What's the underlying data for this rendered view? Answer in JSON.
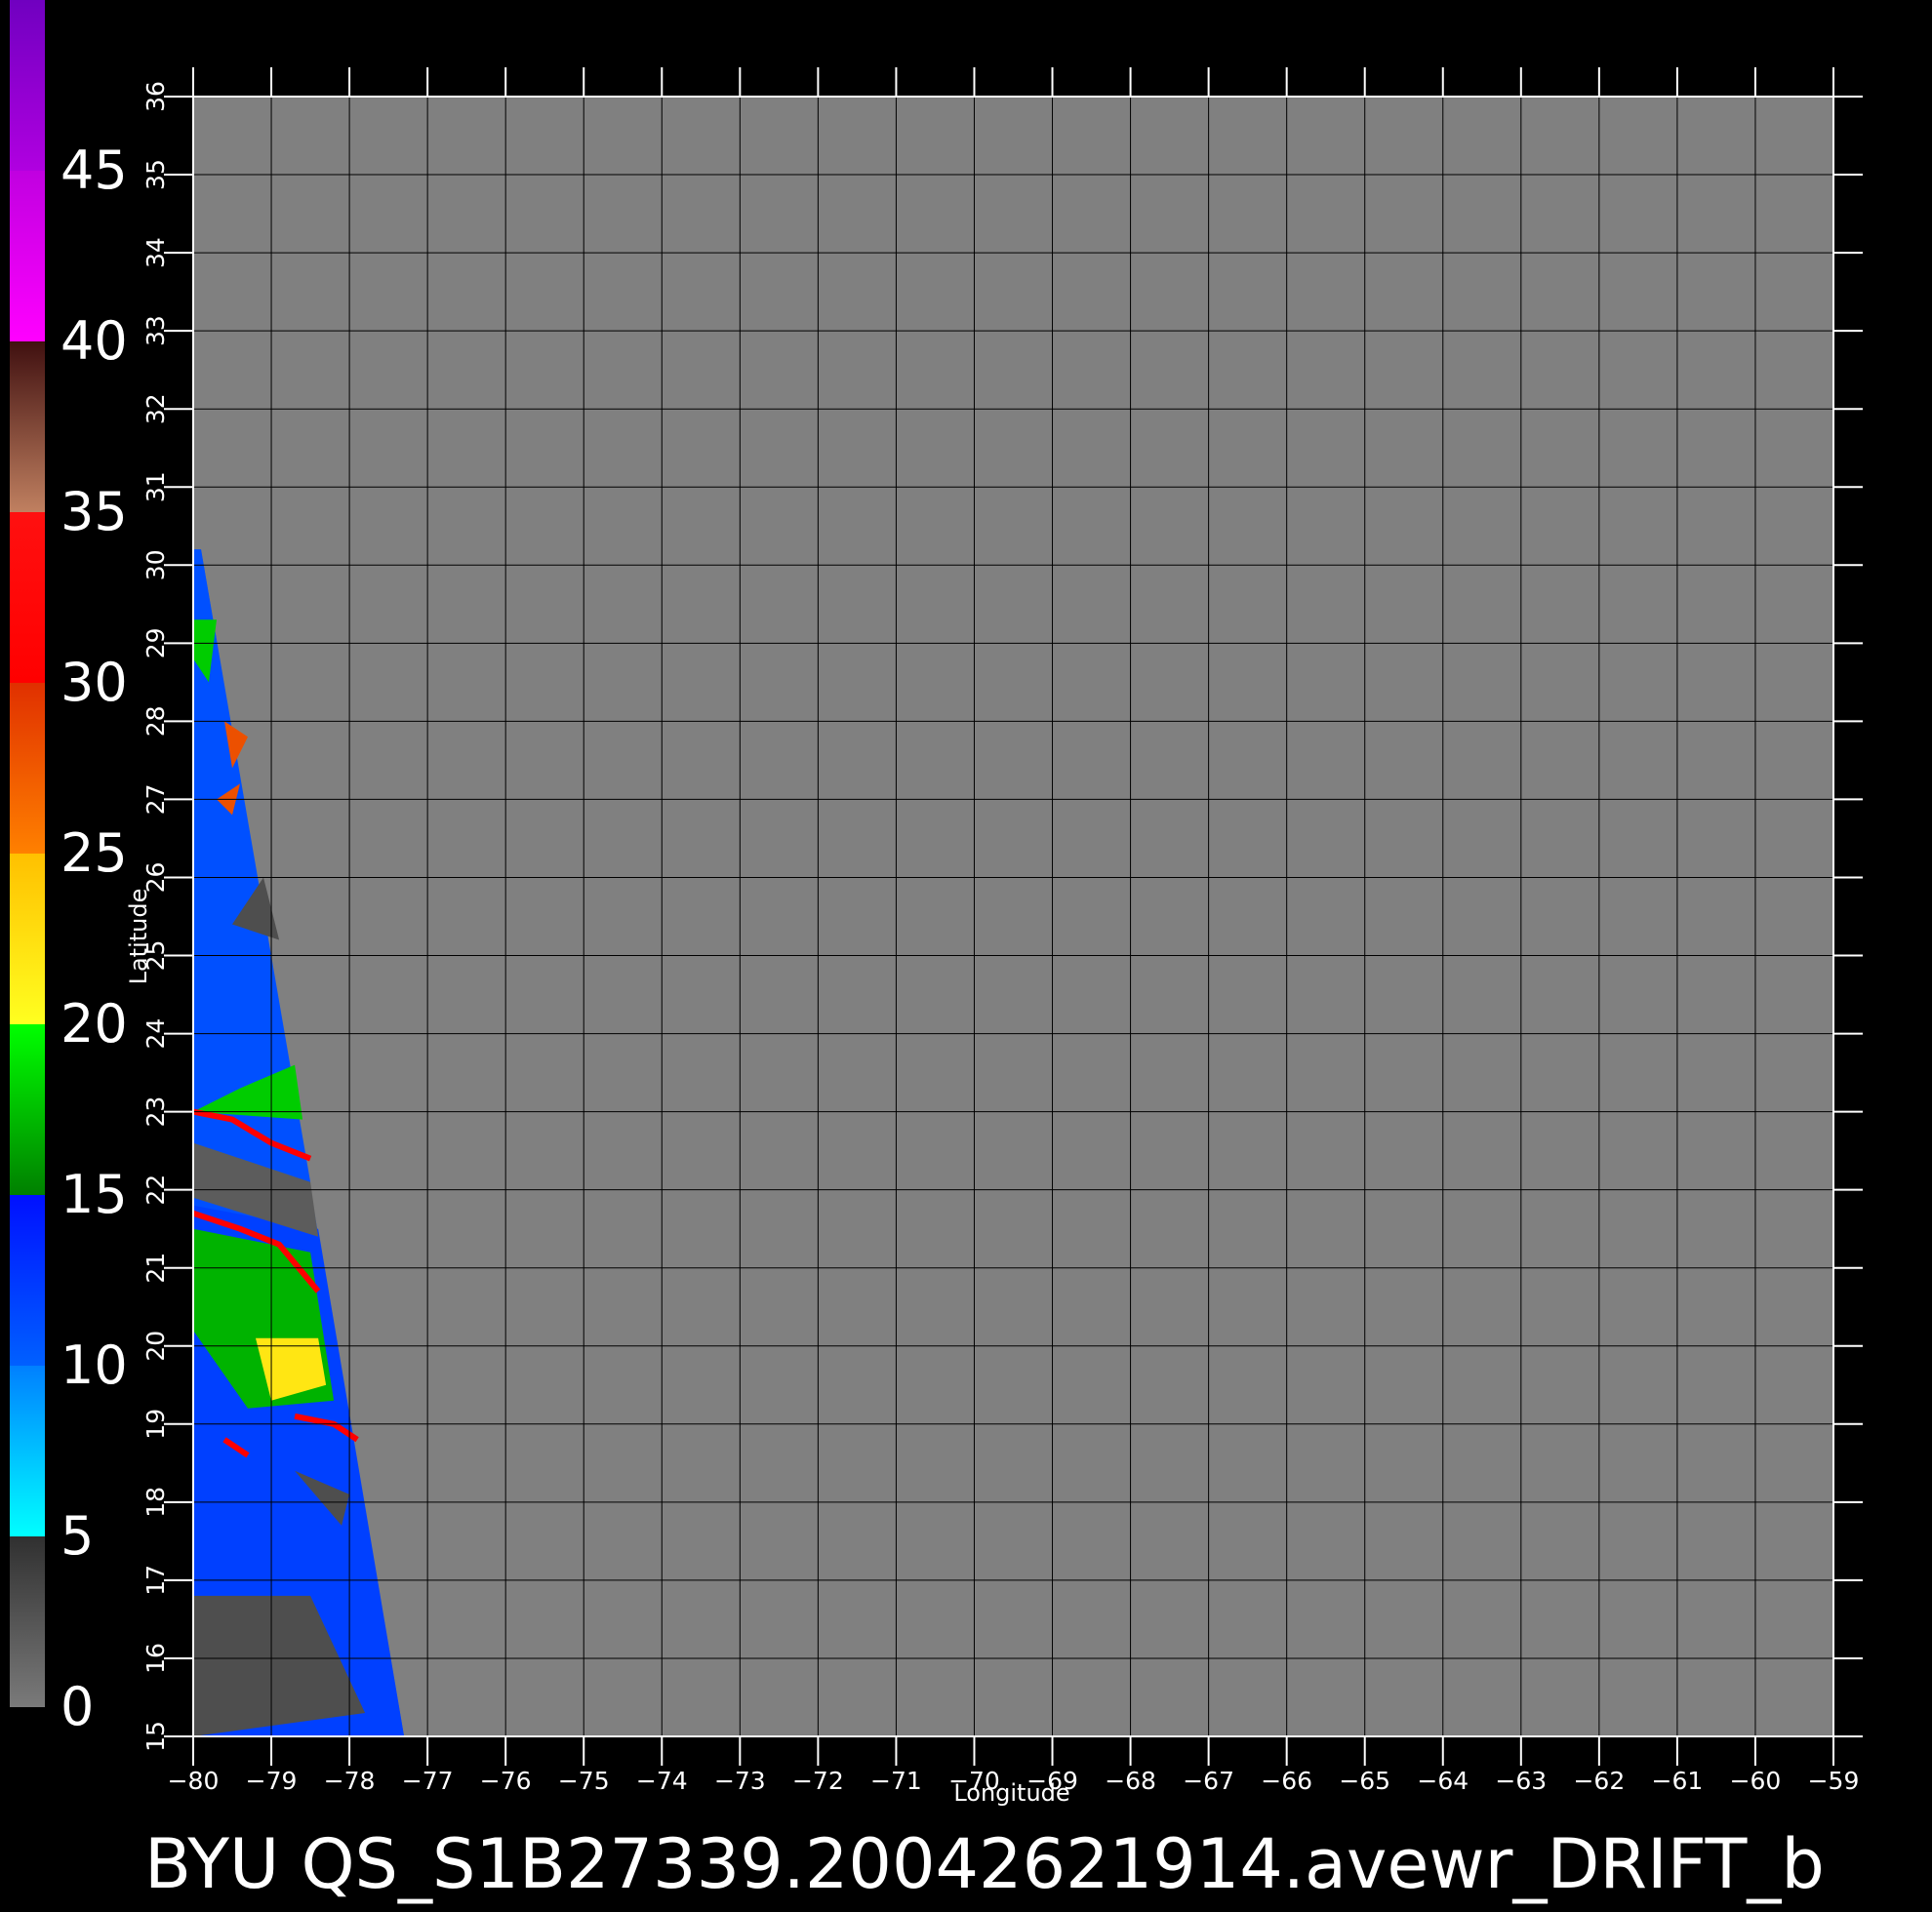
{
  "caption": "BYU  QS_S1B27339.20042621914.avewr_DRIFT_b",
  "colors": {
    "background": "#000000",
    "plot_background": "#808080",
    "grid": "#000000",
    "ticks": "#ffffff"
  },
  "colorbar": {
    "tick_labels": [
      "0",
      "5",
      "10",
      "15",
      "20",
      "25",
      "30",
      "35",
      "40",
      "45"
    ],
    "segments": [
      {
        "from": 0,
        "to": 5,
        "colors": [
          "#7a7a7a",
          "#303030"
        ]
      },
      {
        "from": 5,
        "to": 10,
        "colors": [
          "#00ffff",
          "#0080ff"
        ]
      },
      {
        "from": 10,
        "to": 15,
        "colors": [
          "#0060ff",
          "#0010ff"
        ]
      },
      {
        "from": 15,
        "to": 20,
        "colors": [
          "#008000",
          "#00ff00"
        ]
      },
      {
        "from": 20,
        "to": 25,
        "colors": [
          "#ffff20",
          "#ffc000"
        ]
      },
      {
        "from": 25,
        "to": 30,
        "colors": [
          "#ff8000",
          "#e03000"
        ]
      },
      {
        "from": 30,
        "to": 35,
        "colors": [
          "#ff0000",
          "#ff1010"
        ]
      },
      {
        "from": 35,
        "to": 40,
        "colors": [
          "#c08060",
          "#401010"
        ]
      },
      {
        "from": 40,
        "to": 45,
        "colors": [
          "#ff00ff",
          "#c000e0"
        ]
      },
      {
        "from": 45,
        "to": 50,
        "colors": [
          "#b000e0",
          "#7000c0"
        ]
      }
    ]
  },
  "chart_data": {
    "type": "heatmap",
    "title": "",
    "xlabel": "Longitude",
    "ylabel": "Latitude",
    "xlim": [
      -80,
      -59
    ],
    "ylim": [
      15,
      36
    ],
    "x_ticks": [
      -80,
      -79,
      -78,
      -77,
      -76,
      -75,
      -74,
      -73,
      -72,
      -71,
      -70,
      -69,
      -68,
      -67,
      -66,
      -65,
      -64,
      -63,
      -62,
      -61,
      -60,
      -59
    ],
    "y_ticks": [
      15,
      16,
      17,
      18,
      19,
      20,
      21,
      22,
      23,
      24,
      25,
      26,
      27,
      28,
      29,
      30,
      31,
      32,
      33,
      34,
      35,
      36
    ],
    "grid": true,
    "colorbar_range": [
      0,
      50
    ],
    "swath_polygon": [
      [
        -80,
        30.2
      ],
      [
        -79.9,
        30.2
      ],
      [
        -77.3,
        15
      ],
      [
        -80,
        15
      ]
    ],
    "swath_regions": [
      {
        "value": 11,
        "polygon": [
          [
            -80,
            30.2
          ],
          [
            -79.9,
            30.2
          ],
          [
            -78.5,
            22.1
          ],
          [
            -80,
            22.6
          ]
        ]
      },
      {
        "value": 12,
        "polygon": [
          [
            -80,
            21.8
          ],
          [
            -78.4,
            21.5
          ],
          [
            -77.3,
            15
          ],
          [
            -80,
            15
          ]
        ]
      },
      {
        "value": 2,
        "polygon": [
          [
            -80,
            22.6
          ],
          [
            -78.5,
            22.1
          ],
          [
            -78.4,
            21.4
          ],
          [
            -80,
            21.9
          ]
        ]
      },
      {
        "value": 18,
        "polygon": [
          [
            -80,
            29.3
          ],
          [
            -79.7,
            29.3
          ],
          [
            -79.8,
            28.5
          ],
          [
            -80,
            28.8
          ]
        ]
      },
      {
        "value": 17,
        "polygon": [
          [
            -80,
            21.5
          ],
          [
            -78.5,
            21.2
          ],
          [
            -78.2,
            19.3
          ],
          [
            -79.3,
            19.2
          ],
          [
            -80,
            20.2
          ]
        ]
      },
      {
        "value": 18,
        "polygon": [
          [
            -80,
            23.0
          ],
          [
            -78.6,
            22.9
          ],
          [
            -78.7,
            23.6
          ],
          [
            -79.4,
            23.3
          ]
        ]
      },
      {
        "value": 22,
        "polygon": [
          [
            -79.2,
            20.1
          ],
          [
            -78.4,
            20.1
          ],
          [
            -78.3,
            19.5
          ],
          [
            -79.0,
            19.3
          ]
        ]
      },
      {
        "value": 28,
        "polygon": [
          [
            -79.7,
            27.0
          ],
          [
            -79.4,
            27.2
          ],
          [
            -79.5,
            26.8
          ]
        ]
      },
      {
        "value": 28,
        "polygon": [
          [
            -79.6,
            28.0
          ],
          [
            -79.3,
            27.8
          ],
          [
            -79.5,
            27.4
          ]
        ]
      },
      {
        "value": 3,
        "polygon": [
          [
            -80,
            16.8
          ],
          [
            -78.5,
            16.8
          ],
          [
            -77.8,
            15.3
          ],
          [
            -80,
            15
          ]
        ]
      },
      {
        "value": 3,
        "polygon": [
          [
            -79.1,
            26.0
          ],
          [
            -78.9,
            25.2
          ],
          [
            -79.5,
            25.4
          ]
        ]
      },
      {
        "value": 3,
        "polygon": [
          [
            -78.7,
            18.4
          ],
          [
            -78.0,
            18.1
          ],
          [
            -78.1,
            17.7
          ]
        ]
      }
    ],
    "boundaries": [
      {
        "value": 30,
        "points": [
          [
            -80,
            23.0
          ],
          [
            -79.5,
            22.9
          ],
          [
            -79.0,
            22.6
          ],
          [
            -78.5,
            22.4
          ]
        ]
      },
      {
        "value": 30,
        "points": [
          [
            -80,
            21.7
          ],
          [
            -79.4,
            21.5
          ],
          [
            -78.9,
            21.3
          ],
          [
            -78.4,
            20.7
          ]
        ]
      },
      {
        "value": 30,
        "points": [
          [
            -78.7,
            19.1
          ],
          [
            -78.2,
            19.0
          ],
          [
            -77.9,
            18.8
          ]
        ]
      },
      {
        "value": 30,
        "points": [
          [
            -79.6,
            18.8
          ],
          [
            -79.3,
            18.6
          ]
        ]
      }
    ]
  }
}
